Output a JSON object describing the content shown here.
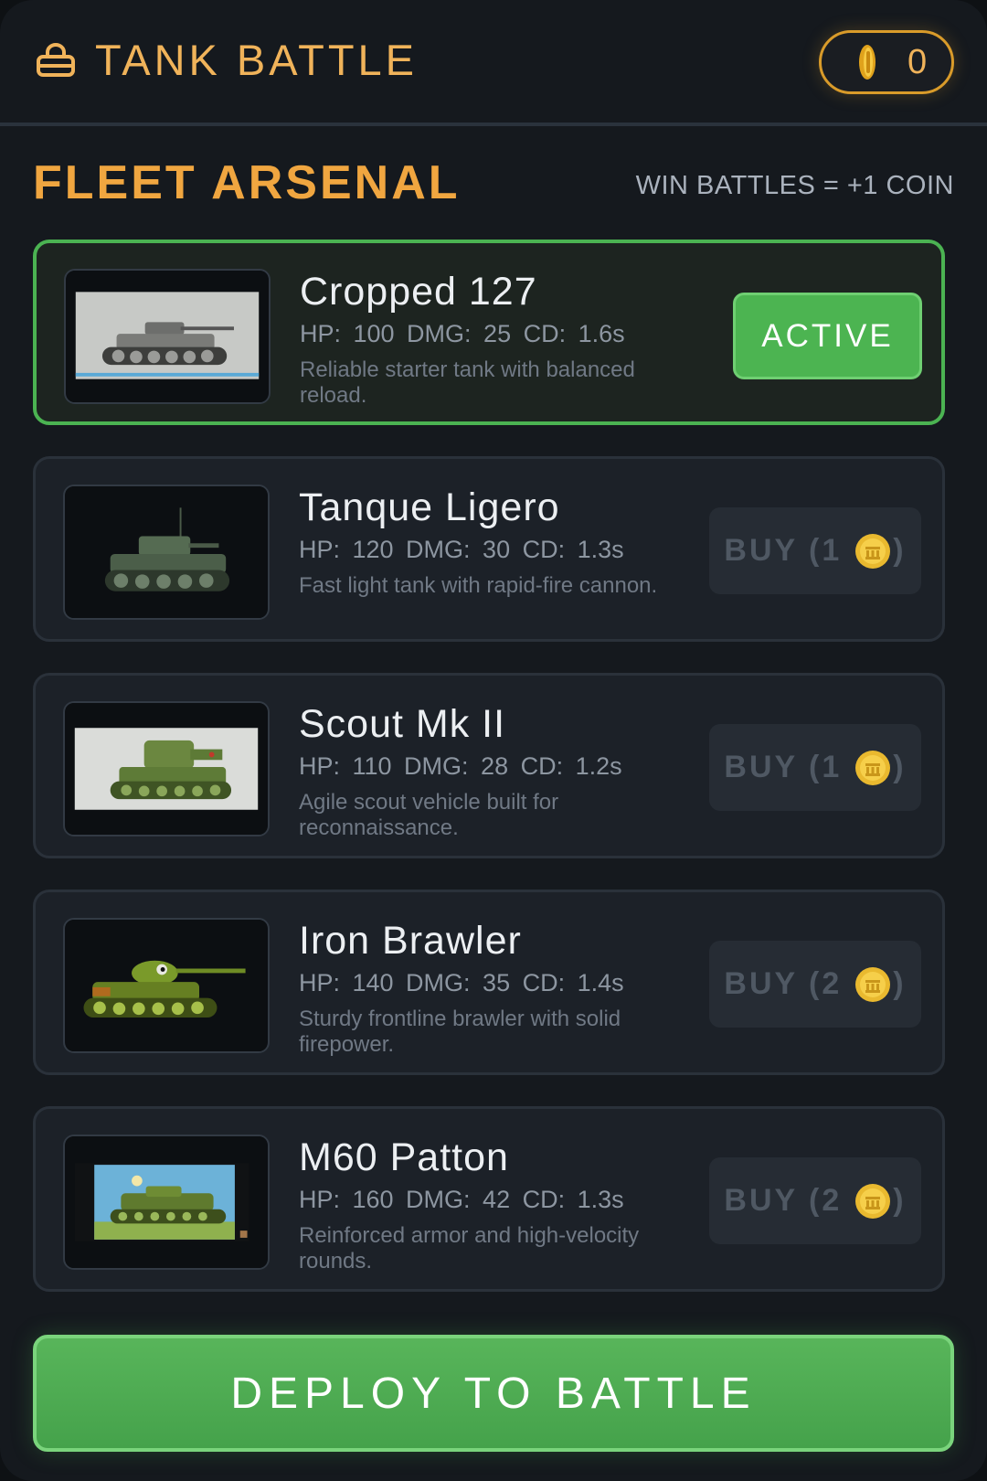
{
  "header": {
    "title": "TANK BATTLE",
    "coin_count": "0",
    "accent_color": "#f0b35a",
    "icon": "lock-icon"
  },
  "section": {
    "title": "FLEET ARSENAL",
    "note": "WIN BATTLES = +1 COIN"
  },
  "tanks": [
    {
      "name": "Cropped 127",
      "stats": "HP: 100  DMG: 25  CD: 1.6s",
      "description": "Reliable starter tank with balanced reload.",
      "status": "active",
      "button_label": "ACTIVE"
    },
    {
      "name": "Tanque Ligero",
      "stats": "HP: 120  DMG: 30  CD: 1.3s",
      "description": "Fast light tank with rapid-fire cannon.",
      "status": "locked",
      "buy_prefix": "BUY (1",
      "buy_suffix": ")"
    },
    {
      "name": "Scout Mk II",
      "stats": "HP: 110  DMG: 28  CD: 1.2s",
      "description": "Agile scout vehicle built for reconnaissance.",
      "status": "locked",
      "buy_prefix": "BUY (1",
      "buy_suffix": ")"
    },
    {
      "name": "Iron Brawler",
      "stats": "HP: 140  DMG: 35  CD: 1.4s",
      "description": "Sturdy frontline brawler with solid firepower.",
      "status": "locked",
      "buy_prefix": "BUY (2",
      "buy_suffix": ")"
    },
    {
      "name": "M60 Patton",
      "stats": "HP: 160  DMG: 42  CD: 1.3s",
      "description": "Reinforced armor and high-velocity rounds.",
      "status": "locked",
      "buy_prefix": "BUY (2",
      "buy_suffix": ")"
    }
  ],
  "deploy_label": "DEPLOY TO BATTLE",
  "colors": {
    "active_green": "#4cb451",
    "gold": "#f0b35a",
    "background": "#15191e"
  }
}
